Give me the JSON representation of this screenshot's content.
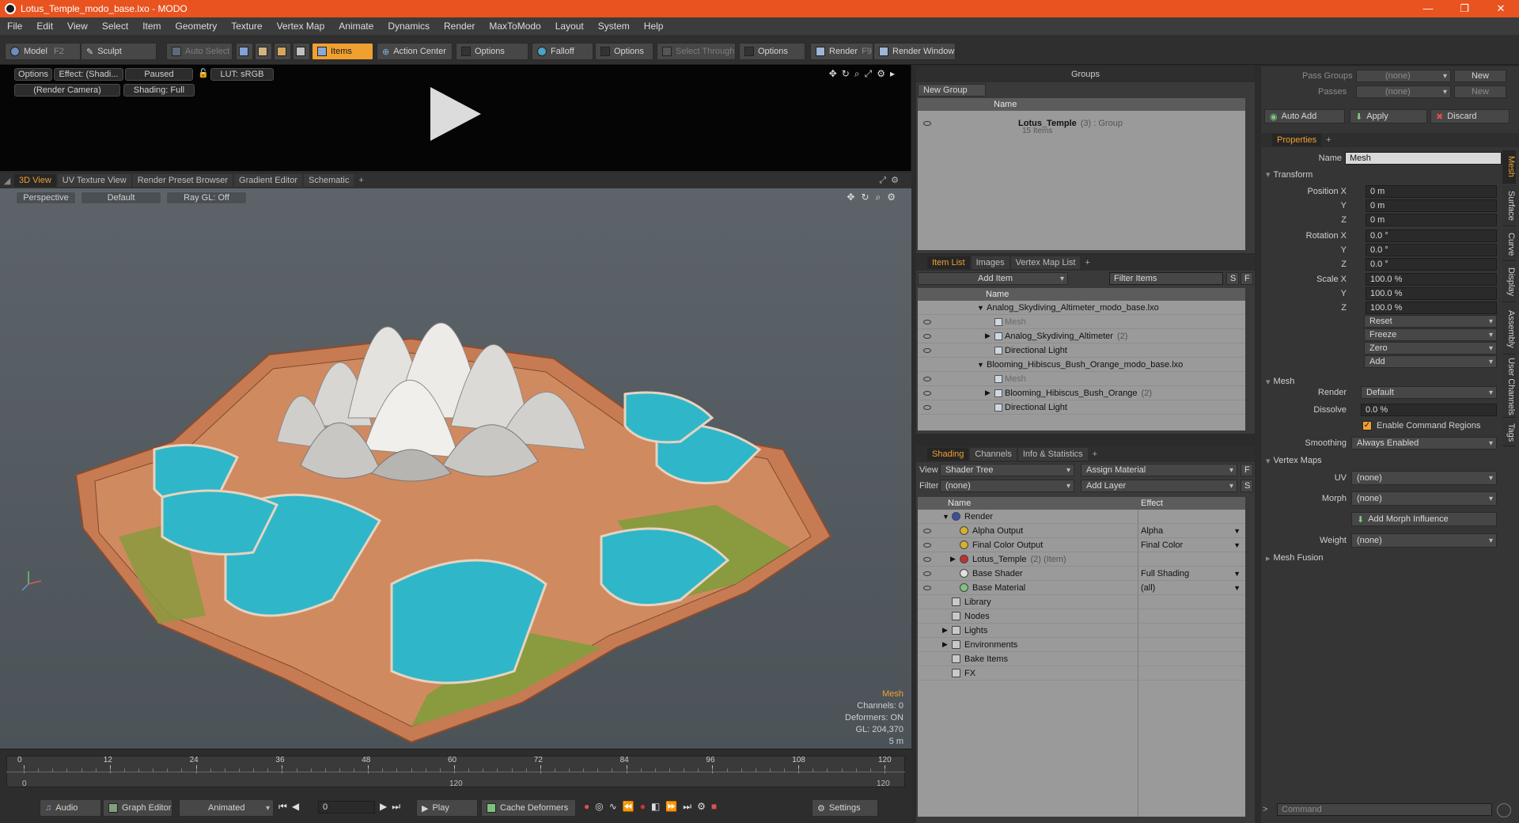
{
  "window": {
    "title": "Lotus_Temple_modo_base.lxo - MODO",
    "min": "—",
    "restore": "❐",
    "close": "✕"
  },
  "menu": [
    "File",
    "Edit",
    "View",
    "Select",
    "Item",
    "Geometry",
    "Texture",
    "Vertex Map",
    "Animate",
    "Dynamics",
    "Render",
    "MaxToModo",
    "Layout",
    "System",
    "Help"
  ],
  "toolbar": {
    "model": "Model",
    "model_key": "F2",
    "sculpt": "Sculpt",
    "auto_select": "Auto Select",
    "items": "Items",
    "action_center": "Action Center",
    "options1": "Options",
    "falloff": "Falloff",
    "options2": "Options",
    "select_through": "Select Through",
    "options3": "Options",
    "render": "Render",
    "render_key": "F9",
    "render_window": "Render Window"
  },
  "preview": {
    "options": "Options",
    "effect": "Effect: (Shadi...",
    "paused": "Paused",
    "lut": "LUT: sRGB",
    "camera": "(Render Camera)",
    "shading": "Shading: Full"
  },
  "view_tabs": [
    "3D View",
    "UV Texture View",
    "Render Preset Browser",
    "Gradient Editor",
    "Schematic"
  ],
  "viewport": {
    "perspective": "Perspective",
    "default": "Default",
    "raygl": "Ray GL: Off",
    "info_mesh": "Mesh",
    "info_channels": "Channels: 0",
    "info_deformers": "Deformers: ON",
    "info_gl": "GL: 204,370",
    "info_scale": "5 m"
  },
  "timeline": {
    "ticks": [
      "0",
      "12",
      "24",
      "36",
      "48",
      "60",
      "72",
      "84",
      "96",
      "108",
      "120"
    ],
    "start": "0",
    "mid": "120",
    "end": "120"
  },
  "bottom": {
    "audio": "Audio",
    "graph_editor": "Graph Editor",
    "animated": "Animated",
    "frame": "0",
    "play": "Play",
    "cache": "Cache Deformers",
    "settings": "Settings"
  },
  "groups": {
    "title": "Groups",
    "new_group": "New Group",
    "col_name": "Name",
    "item_name": "Lotus_Temple",
    "item_count": "(3) : Group",
    "item_sub": "15 Items"
  },
  "itemlist": {
    "tabs": [
      "Item List",
      "Images",
      "Vertex Map List"
    ],
    "add_item": "Add Item",
    "filter": "Filter Items",
    "s": "S",
    "f": "F",
    "col_name": "Name",
    "rows": [
      {
        "label": "Analog_Skydiving_Altimeter_modo_base.lxo",
        "indent": 0,
        "dim": false,
        "suffix": ""
      },
      {
        "label": "Mesh",
        "indent": 1,
        "dim": true,
        "suffix": ""
      },
      {
        "label": "Analog_Skydiving_Altimeter",
        "indent": 1,
        "dim": false,
        "suffix": "(2)"
      },
      {
        "label": "Directional Light",
        "indent": 1,
        "dim": false,
        "suffix": ""
      },
      {
        "label": "Blooming_Hibiscus_Bush_Orange_modo_base.lxo",
        "indent": 0,
        "dim": false,
        "suffix": ""
      },
      {
        "label": "Mesh",
        "indent": 1,
        "dim": true,
        "suffix": ""
      },
      {
        "label": "Blooming_Hibiscus_Bush_Orange",
        "indent": 1,
        "dim": false,
        "suffix": "(2)"
      },
      {
        "label": "Directional Light",
        "indent": 1,
        "dim": false,
        "suffix": ""
      }
    ]
  },
  "shading": {
    "tabs": [
      "Shading",
      "Channels",
      "Info & Statistics"
    ],
    "view_label": "View",
    "view_value": "Shader Tree",
    "assign_material": "Assign Material",
    "f": "F",
    "filter_label": "Filter",
    "filter_value": "(none)",
    "add_layer": "Add Layer",
    "s": "S",
    "col_name": "Name",
    "col_effect": "Effect",
    "rows": [
      {
        "label": "Render",
        "effect": "",
        "indent": 0
      },
      {
        "label": "Alpha Output",
        "effect": "Alpha",
        "indent": 1
      },
      {
        "label": "Final Color Output",
        "effect": "Final Color",
        "indent": 1
      },
      {
        "label": "Lotus_Temple",
        "effect": "",
        "indent": 1,
        "suffix": "(2) (Item)"
      },
      {
        "label": "Base Shader",
        "effect": "Full Shading",
        "indent": 1
      },
      {
        "label": "Base Material",
        "effect": "(all)",
        "indent": 1
      },
      {
        "label": "Library",
        "effect": "",
        "indent": 0
      },
      {
        "label": "Nodes",
        "effect": "",
        "indent": 0
      },
      {
        "label": "Lights",
        "effect": "",
        "indent": 0
      },
      {
        "label": "Environments",
        "effect": "",
        "indent": 0
      },
      {
        "label": "Bake Items",
        "effect": "",
        "indent": 0
      },
      {
        "label": "FX",
        "effect": "",
        "indent": 0
      }
    ]
  },
  "props": {
    "pass_groups": "Pass Groups",
    "pass_groups_val": "(none)",
    "new": "New",
    "passes": "Passes",
    "passes_val": "(none)",
    "new2": "New",
    "auto_add": "Auto Add",
    "apply": "Apply",
    "discard": "Discard",
    "tab": "Properties",
    "name_label": "Name",
    "name_val": "Mesh",
    "transform": "Transform",
    "pos_label": "Position X",
    "y": "Y",
    "z": "Z",
    "pos": [
      "0 m",
      "0 m",
      "0 m"
    ],
    "rot_label": "Rotation X",
    "rot": [
      "0.0 °",
      "0.0 °",
      "0.0 °"
    ],
    "scale_label": "Scale X",
    "scale": [
      "100.0 %",
      "100.0 %",
      "100.0 %"
    ],
    "reset": "Reset",
    "freeze": "Freeze",
    "zero": "Zero",
    "add": "Add",
    "mesh": "Mesh",
    "render_label": "Render",
    "render_val": "Default",
    "dissolve_label": "Dissolve",
    "dissolve_val": "0.0 %",
    "enable_regions": "Enable Command Regions",
    "smoothing_label": "Smoothing",
    "smoothing_val": "Always Enabled",
    "vertex_maps": "Vertex Maps",
    "uv_label": "UV",
    "uv_val": "(none)",
    "morph_label": "Morph",
    "morph_val": "(none)",
    "add_morph": "Add Morph Influence",
    "weight_label": "Weight",
    "weight_val": "(none)",
    "mesh_fusion": "Mesh Fusion",
    "command": "Command",
    "side_tabs": [
      "Mesh",
      "Surface",
      "Curve",
      "Display",
      "Assembly",
      "User Channels",
      "Tags"
    ]
  }
}
